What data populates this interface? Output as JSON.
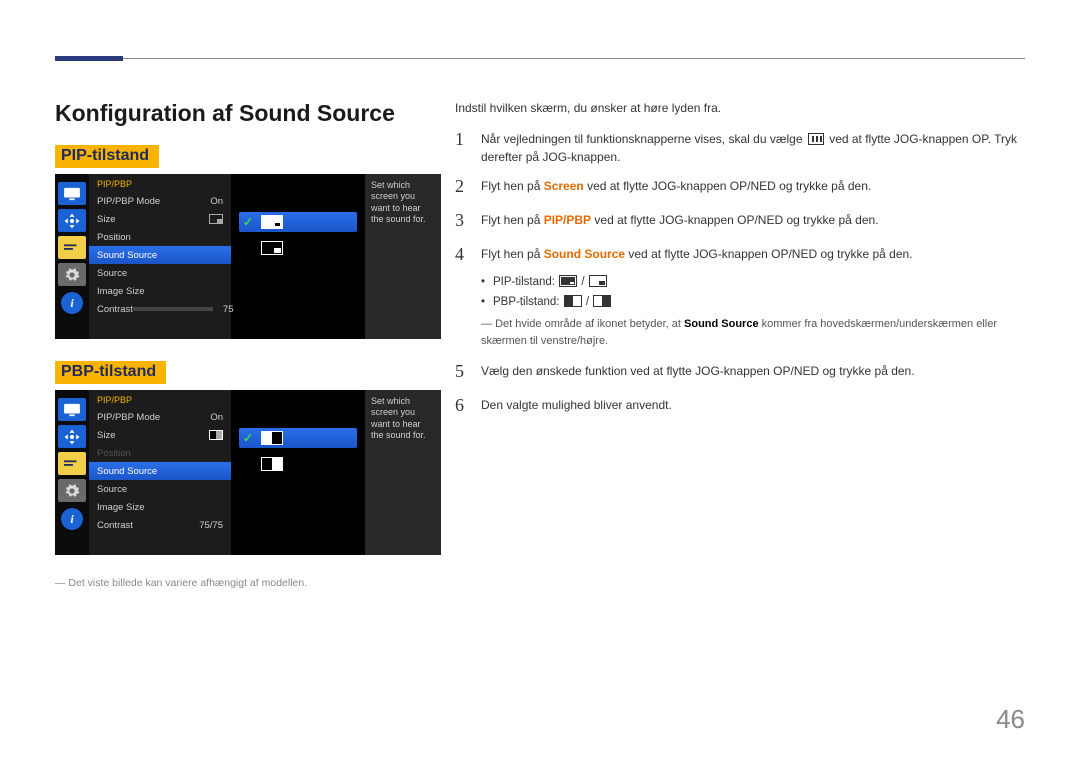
{
  "page": {
    "title": "Konfiguration af Sound Source",
    "number": "46",
    "intro": "Indstil hvilken skærm, du ønsker at høre lyden fra.",
    "imgnote": "Det viste billede kan variere afhængigt af modellen."
  },
  "modes": {
    "pip_heading": "PIP-tilstand",
    "pbp_heading": "PBP-tilstand"
  },
  "osd": {
    "title": "PIP/PBP",
    "help": "Set which screen you want to hear the sound for.",
    "items": {
      "mode": "PIP/PBP Mode",
      "mode_val": "On",
      "size": "Size",
      "position": "Position",
      "sound": "Sound Source",
      "source": "Source",
      "imgsize": "Image Size",
      "contrast": "Contrast",
      "contrast_val_pip": "75",
      "contrast_val_pbp": "75/75"
    }
  },
  "steps": {
    "s1a": "Når vejledningen til funktionsknapperne vises, skal du vælge ",
    "s1b": " ved at flytte JOG-knappen OP. Tryk derefter på JOG-knappen.",
    "s2a": "Flyt hen på ",
    "s2_screen": "Screen",
    "s2b": " ved at flytte JOG-knappen OP/NED og trykke på den.",
    "s3a": "Flyt hen på ",
    "s3_pip": "PIP/PBP",
    "s3b": " ved at flytte JOG-knappen OP/NED og trykke på den.",
    "s4a": "Flyt hen på ",
    "s4_ss": "Sound Source",
    "s4b": " ved at flytte JOG-knappen OP/NED og trykke på den.",
    "bullet_pip": "PIP-tilstand: ",
    "bullet_pbp": "PBP-tilstand: ",
    "note4a": "Det hvide område af ikonet betyder, at ",
    "note4b": " kommer fra hovedskærmen/underskærmen eller skærmen til venstre/højre.",
    "s5": "Vælg den ønskede funktion ved at flytte JOG-knappen OP/NED og trykke på den.",
    "s6": "Den valgte mulighed bliver anvendt."
  }
}
